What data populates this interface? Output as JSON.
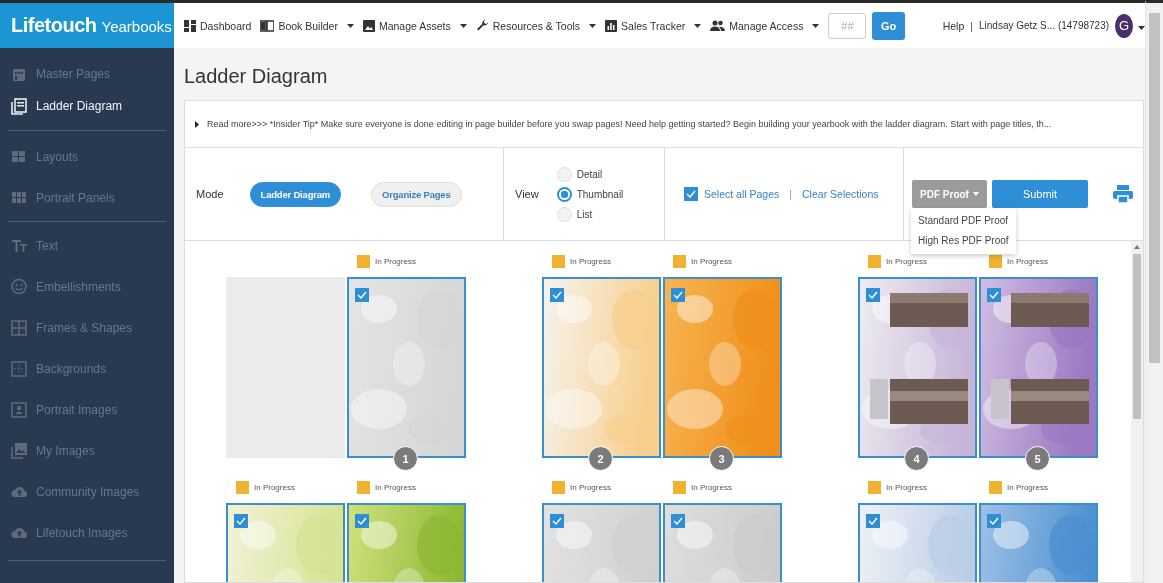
{
  "brand": {
    "name": "Lifetouch",
    "suffix": "Yearbooks"
  },
  "nav": {
    "items": [
      {
        "label": "Dashboard",
        "dropdown": false
      },
      {
        "label": "Book Builder",
        "dropdown": true
      },
      {
        "label": "Manage Assets",
        "dropdown": true
      },
      {
        "label": "Resources & Tools",
        "dropdown": true
      },
      {
        "label": "Sales Tracker",
        "dropdown": true
      },
      {
        "label": "Manage Access",
        "dropdown": true
      }
    ],
    "page_field": {
      "placeholder": "##"
    },
    "go_button": "Go",
    "help": "Help",
    "separator": "|",
    "user": "Lindsay Getz S... (14798723)",
    "avatar": "G"
  },
  "sidebar": {
    "groups": [
      [
        {
          "label": "Master Pages",
          "selected": false
        },
        {
          "label": "Ladder Diagram",
          "selected": true
        }
      ],
      [
        {
          "label": "Layouts",
          "selected": false
        },
        {
          "label": "Portrait Panels",
          "selected": false
        }
      ],
      [
        {
          "label": "Text",
          "selected": false
        },
        {
          "label": "Embellishments",
          "selected": false
        },
        {
          "label": "Frames & Shapes",
          "selected": false
        },
        {
          "label": "Backgrounds",
          "selected": false
        },
        {
          "label": "Portrait Images",
          "selected": false
        },
        {
          "label": "My Images",
          "selected": false
        },
        {
          "label": "Community Images",
          "selected": false
        },
        {
          "label": "Lifetouch Images",
          "selected": false
        }
      ]
    ]
  },
  "title": "Ladder Diagram",
  "tip": "Read more>>> *Insider Tip* Make sure everyone is done editing in page builder before you swap pages! Need help getting started? Begin building your yearbook with the ladder diagram. Start with page titles, th...",
  "toolbar": {
    "mode_label": "Mode",
    "modes": [
      {
        "label": "Ladder Diagram",
        "selected": true
      },
      {
        "label": "Organize Pages",
        "selected": false
      }
    ],
    "view_label": "View",
    "views": [
      {
        "label": "Detail",
        "selected": false
      },
      {
        "label": "Thumbnail",
        "selected": true
      },
      {
        "label": "List",
        "selected": false
      }
    ],
    "select_all": {
      "label": "Select all Pages",
      "checked": true
    },
    "divider": "|",
    "clear": "Clear Selections",
    "pdf_button": "PDF Proof",
    "pdf_menu": [
      "Standard PDF Proof",
      "High Res PDF Proof"
    ],
    "submit": "Submit"
  },
  "ladder": {
    "rows": [
      {
        "spreads": [
          {
            "pages": [
              {
                "kind": "blank"
              },
              {
                "kind": "page",
                "status": "In Progress",
                "checked": true,
                "number": "1"
              }
            ]
          },
          {
            "pages": [
              {
                "kind": "page",
                "status": "In Progress",
                "checked": true,
                "number": "2"
              },
              {
                "kind": "page",
                "status": "In Progress",
                "checked": true,
                "number": "3"
              }
            ]
          },
          {
            "pages": [
              {
                "kind": "page",
                "status": "In Progress",
                "checked": true,
                "number": "4"
              },
              {
                "kind": "page",
                "status": "In Progress",
                "checked": true,
                "number": "5"
              }
            ]
          }
        ]
      },
      {
        "spreads": [
          {
            "pages": [
              {
                "kind": "page",
                "status": "In Progress",
                "checked": true
              },
              {
                "kind": "page",
                "status": "In Progress",
                "checked": true
              }
            ]
          },
          {
            "pages": [
              {
                "kind": "page",
                "status": "In Progress",
                "checked": true
              },
              {
                "kind": "page",
                "status": "In Progress",
                "checked": true
              }
            ]
          },
          {
            "pages": [
              {
                "kind": "page",
                "status": "In Progress",
                "checked": true
              },
              {
                "kind": "page",
                "status": "In Progress",
                "checked": true
              }
            ]
          }
        ]
      }
    ]
  }
}
